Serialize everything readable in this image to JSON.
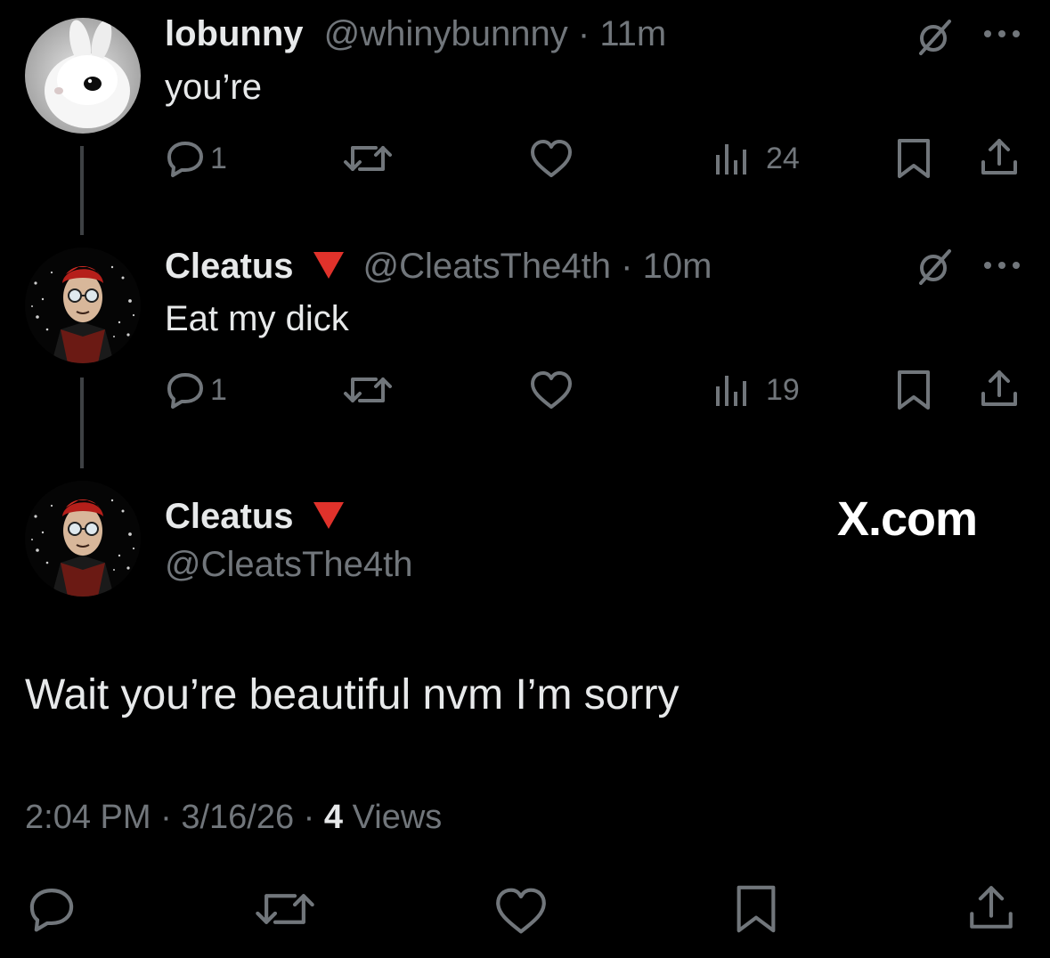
{
  "tweets": [
    {
      "name": "lobunny",
      "handle": "@whinybunnny",
      "separator": "·",
      "time": "11m",
      "text": "you’re",
      "replies": "1",
      "views": "24"
    },
    {
      "name": "Cleatus",
      "handle": "@CleatsThe4th",
      "separator": "·",
      "time": "10m",
      "text": "Eat my dick",
      "replies": "1",
      "views": "19"
    }
  ],
  "main": {
    "name": "Cleatus",
    "handle": "@CleatsThe4th",
    "text": "Wait you’re beautiful nvm I’m sorry",
    "time": "2:04 PM",
    "sep1": "·",
    "date": "3/16/26",
    "sep2": "·",
    "views_count": "4",
    "views_label": "Views",
    "watermark": "X.com"
  },
  "colors": {
    "background": "#000000",
    "text": "#e7e9ea",
    "muted": "#71767b",
    "badge": "#e0322b"
  }
}
